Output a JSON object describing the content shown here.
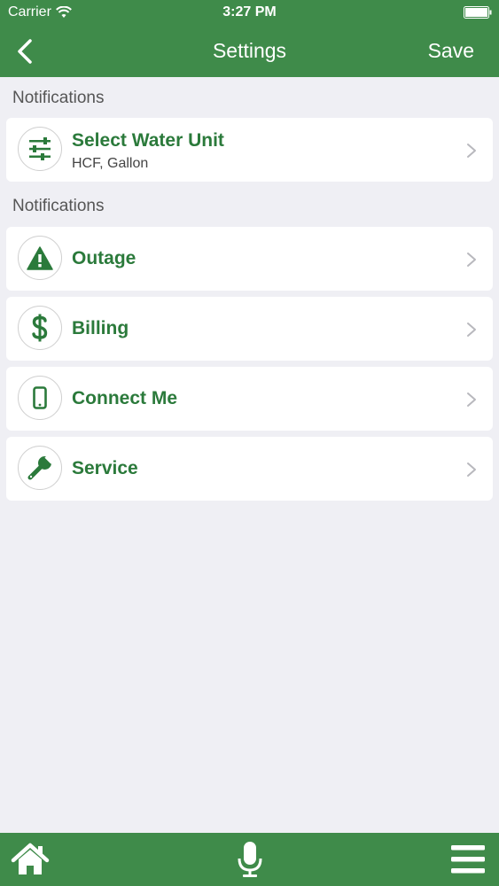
{
  "status_bar": {
    "carrier": "Carrier",
    "time": "3:27 PM"
  },
  "nav": {
    "title": "Settings",
    "save_label": "Save"
  },
  "sections": [
    {
      "header": "Notifications",
      "items": [
        {
          "title": "Select Water Unit",
          "subtitle": "HCF, Gallon",
          "icon": "sliders-icon"
        }
      ]
    },
    {
      "header": "Notifications",
      "items": [
        {
          "title": "Outage",
          "icon": "warning-icon"
        },
        {
          "title": "Billing",
          "icon": "dollar-icon"
        },
        {
          "title": "Connect Me",
          "icon": "phone-icon"
        },
        {
          "title": "Service",
          "icon": "wrench-icon"
        }
      ]
    }
  ],
  "colors": {
    "brand_green": "#3f8b4a",
    "title_green": "#2b7a3b",
    "background": "#efeff4"
  },
  "tabbar": {
    "items": [
      "home-icon",
      "microphone-icon",
      "menu-icon"
    ]
  }
}
